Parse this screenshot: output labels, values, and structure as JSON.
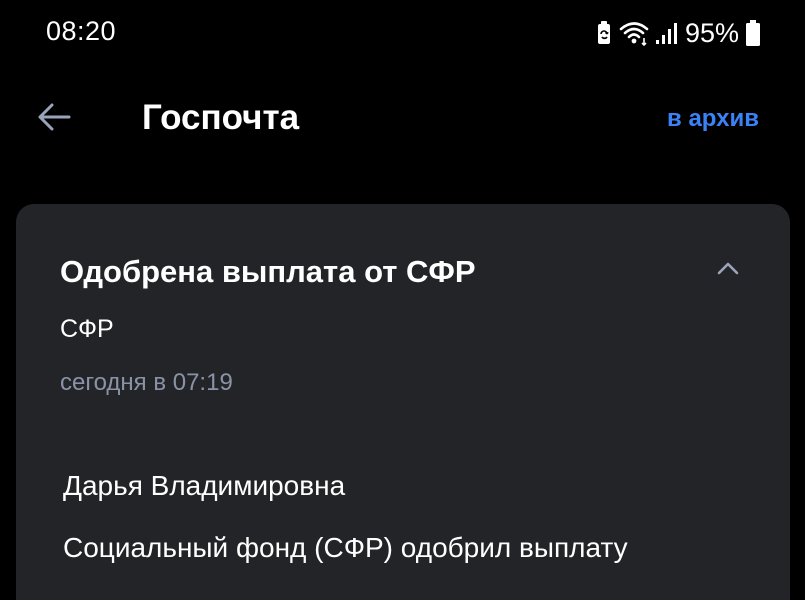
{
  "status_bar": {
    "time": "08:20",
    "battery_percent": "95%",
    "icons": [
      "battery-saver-icon",
      "wifi-icon",
      "signal-icon",
      "battery-icon"
    ]
  },
  "header": {
    "back_icon": "arrow-left-icon",
    "title": "Госпочта",
    "archive_label": "в архив"
  },
  "message": {
    "subject": "Одобрена выплата от СФР",
    "sender": "СФР",
    "date": "сегодня в 07:19",
    "collapse_icon": "chevron-up-icon",
    "greeting": "Дарья Владимировна",
    "body": "Социальный фонд (СФР) одобрил выплату"
  },
  "colors": {
    "background": "#000000",
    "card": "#232428",
    "accent": "#3b82f6",
    "muted_text": "#8a93a6"
  }
}
